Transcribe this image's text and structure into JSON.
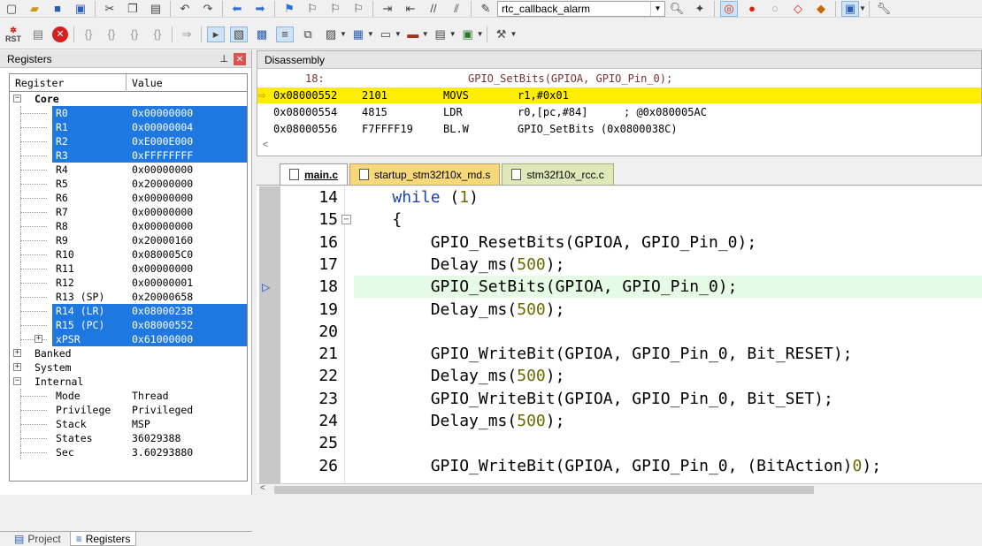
{
  "toolbar": {
    "target_combo": "rtc_callback_alarm",
    "rst_label": "RST"
  },
  "registers_panel": {
    "title": "Registers",
    "columns": [
      "Register",
      "Value"
    ],
    "rows": [
      {
        "name": "Core",
        "value": "",
        "level": 0,
        "expander": "−",
        "bold": true
      },
      {
        "name": "R0",
        "value": "0x00000000",
        "level": 1,
        "sel": true
      },
      {
        "name": "R1",
        "value": "0x00000004",
        "level": 1,
        "sel": true
      },
      {
        "name": "R2",
        "value": "0xE000E000",
        "level": 1,
        "sel": true
      },
      {
        "name": "R3",
        "value": "0xFFFFFFFF",
        "level": 1,
        "sel": true
      },
      {
        "name": "R4",
        "value": "0x00000000",
        "level": 1
      },
      {
        "name": "R5",
        "value": "0x20000000",
        "level": 1
      },
      {
        "name": "R6",
        "value": "0x00000000",
        "level": 1
      },
      {
        "name": "R7",
        "value": "0x00000000",
        "level": 1
      },
      {
        "name": "R8",
        "value": "0x00000000",
        "level": 1
      },
      {
        "name": "R9",
        "value": "0x20000160",
        "level": 1
      },
      {
        "name": "R10",
        "value": "0x080005C0",
        "level": 1
      },
      {
        "name": "R11",
        "value": "0x00000000",
        "level": 1
      },
      {
        "name": "R12",
        "value": "0x00000001",
        "level": 1
      },
      {
        "name": "R13 (SP)",
        "value": "0x20000658",
        "level": 1
      },
      {
        "name": "R14 (LR)",
        "value": "0x0800023B",
        "level": 1,
        "sel": true
      },
      {
        "name": "R15 (PC)",
        "value": "0x08000552",
        "level": 1,
        "sel": true
      },
      {
        "name": "xPSR",
        "value": "0x61000000",
        "level": 1,
        "sel": true,
        "expander": "+"
      },
      {
        "name": "Banked",
        "value": "",
        "level": 0,
        "expander": "+"
      },
      {
        "name": "System",
        "value": "",
        "level": 0,
        "expander": "+"
      },
      {
        "name": "Internal",
        "value": "",
        "level": 0,
        "expander": "−"
      },
      {
        "name": "Mode",
        "value": "Thread",
        "level": 1
      },
      {
        "name": "Privilege",
        "value": "Privileged",
        "level": 1
      },
      {
        "name": "Stack",
        "value": "MSP",
        "level": 1
      },
      {
        "name": "States",
        "value": "36029388",
        "level": 1
      },
      {
        "name": "Sec",
        "value": "3.60293880",
        "level": 1
      }
    ],
    "tabs": [
      "Project",
      "Registers"
    ]
  },
  "disassembly_panel": {
    "title": "Disassembly",
    "lines": [
      {
        "addr": "18:",
        "code": "",
        "mnem": "",
        "ops": "GPIO_SetBits(GPIOA, GPIO_Pin_0);",
        "comment": "",
        "src": true
      },
      {
        "addr": "0x08000552",
        "code": "2101",
        "mnem": "MOVS",
        "ops": "r1,#0x01",
        "comment": "",
        "current": true
      },
      {
        "addr": "0x08000554",
        "code": "4815",
        "mnem": "LDR",
        "ops": "r0,[pc,#84]",
        "comment": "; @0x080005AC"
      },
      {
        "addr": "0x08000556",
        "code": "F7FFFF19",
        "mnem": "BL.W",
        "ops": "GPIO_SetBits (0x0800038C)",
        "comment": ""
      }
    ],
    "scroll_left": "<"
  },
  "editor": {
    "tabs": [
      "main.c",
      "startup_stm32f10x_md.s",
      "stm32f10x_rcc.c"
    ],
    "lines": [
      {
        "num": "14",
        "text": "    while (1)"
      },
      {
        "num": "15",
        "text": "    {",
        "fold": true
      },
      {
        "num": "16",
        "text": "        GPIO_ResetBits(GPIOA, GPIO_Pin_0);"
      },
      {
        "num": "17",
        "text": "        Delay_ms(500);"
      },
      {
        "num": "18",
        "text": "        GPIO_SetBits(GPIOA, GPIO_Pin_0);",
        "current": true
      },
      {
        "num": "19",
        "text": "        Delay_ms(500);"
      },
      {
        "num": "20",
        "text": ""
      },
      {
        "num": "21",
        "text": "        GPIO_WriteBit(GPIOA, GPIO_Pin_0, Bit_RESET);"
      },
      {
        "num": "22",
        "text": "        Delay_ms(500);"
      },
      {
        "num": "23",
        "text": "        GPIO_WriteBit(GPIOA, GPIO_Pin_0, Bit_SET);"
      },
      {
        "num": "24",
        "text": "        Delay_ms(500);"
      },
      {
        "num": "25",
        "text": ""
      },
      {
        "num": "26",
        "text": "        GPIO_WriteBit(GPIOA, GPIO_Pin_0, (BitAction)0);"
      }
    ],
    "scroll_left": "<"
  },
  "colors": {
    "selection": "#1e78e0",
    "current_disasm_line": "#ffee00",
    "current_code_line": "#e6fbe6",
    "keyword": "#1b3fb0"
  }
}
